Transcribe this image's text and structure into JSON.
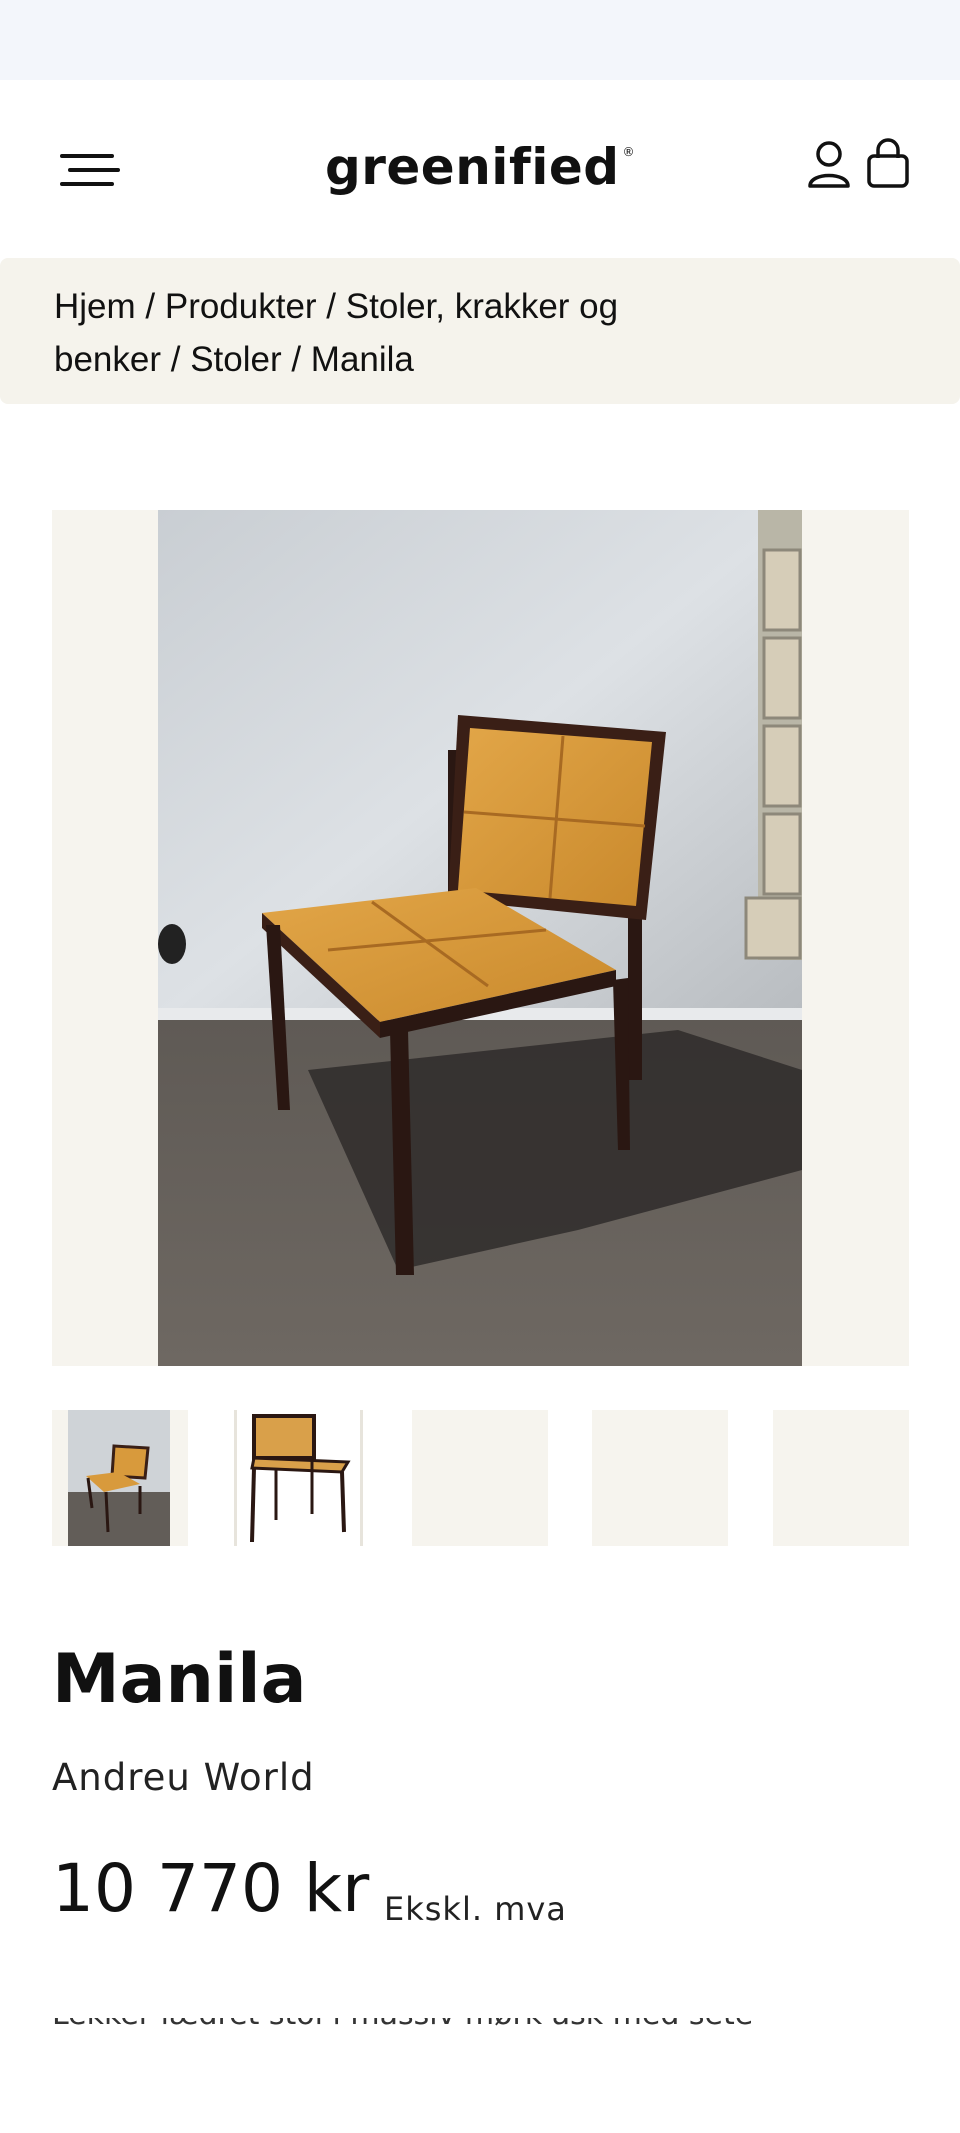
{
  "header": {
    "logo_text": "greenified",
    "logo_mark": "®",
    "menu_icon": "hamburger-menu-icon",
    "account_icon": "user-icon",
    "cart_icon": "shopping-bag-icon"
  },
  "breadcrumb": {
    "text": "Hjem / Produkter / Stoler, krakker og benker / Stoler / Manila"
  },
  "gallery": {
    "thumbnail_count": 5,
    "selected_index": 0
  },
  "product": {
    "title": "Manila",
    "brand": "Andreu World",
    "price": "10 770 kr",
    "vat_note": "Ekskl. mva",
    "description_cut": "Lekker lædret stol i massiv mørk ask med sete"
  },
  "colors": {
    "status_bar": "#f3f6fb",
    "breadcrumb_bg": "#f5f3ec",
    "image_bg": "#f6f4ee",
    "text": "#111111"
  }
}
